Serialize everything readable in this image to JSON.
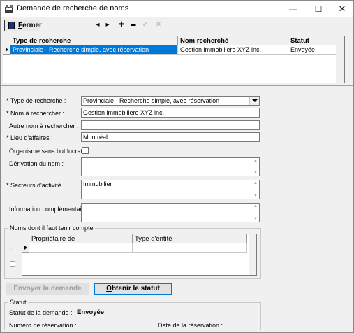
{
  "window": {
    "title": "Demande de recherche de noms",
    "minimize_icon": "minimize-icon",
    "maximize_icon": "maximize-icon",
    "close_icon": "close-icon"
  },
  "toolbar": {
    "close_label_underlined": "F",
    "close_label_rest": "ermer",
    "nav_icons": [
      "prev-record-icon",
      "next-record-icon",
      "add-record-icon",
      "delete-record-icon",
      "confirm-icon",
      "cancel-icon"
    ],
    "nav_glyphs": [
      "◂",
      "▸",
      "✚",
      "▬",
      "✓",
      "✕"
    ]
  },
  "results_grid": {
    "columns": [
      "Type de recherche",
      "Nom recherché",
      "Statut"
    ],
    "rows": [
      {
        "type": "Provinciale - Recherche simple, avec réservation",
        "name": "Gestion immobilière XYZ inc.",
        "status": "Envoyée"
      }
    ]
  },
  "form": {
    "search_type_label": "* Type de recherche :",
    "search_type_value": "Provinciale - Recherche simple, avec réservation",
    "name_label": "* Nom à rechercher :",
    "name_value": "Gestion immobilière XYZ inc.",
    "other_name_label": "Autre nom à rechercher :",
    "other_name_value": "",
    "business_place_label": "* Lieu d'affaires :",
    "business_place_value": "Montréal",
    "nonprofit_label": "Organisme sans but lucratif",
    "derivation_label": "Dérivation du nom :",
    "derivation_value": "",
    "sectors_label": "* Secteurs d'activité :",
    "sectors_value": "Immobilier",
    "extra_info_label": "Information complémentaire :",
    "extra_info_value": ""
  },
  "names_group": {
    "title": "Noms dont il faut tenir compte",
    "columns": [
      "Propriétaire de",
      "Type d'entité"
    ]
  },
  "actions": {
    "send_label": "Envoyer la demande",
    "status_label_underlined": "O",
    "status_label_rest": "btenir le statut"
  },
  "status_group": {
    "title": "Statut",
    "request_status_label": "Statut de la demande :",
    "request_status_value": "Envoyée",
    "reservation_number_label": "Numéro de réservation :",
    "reservation_number_value": "",
    "reservation_date_label": "Date de la réservation :",
    "reservation_date_value": ""
  }
}
